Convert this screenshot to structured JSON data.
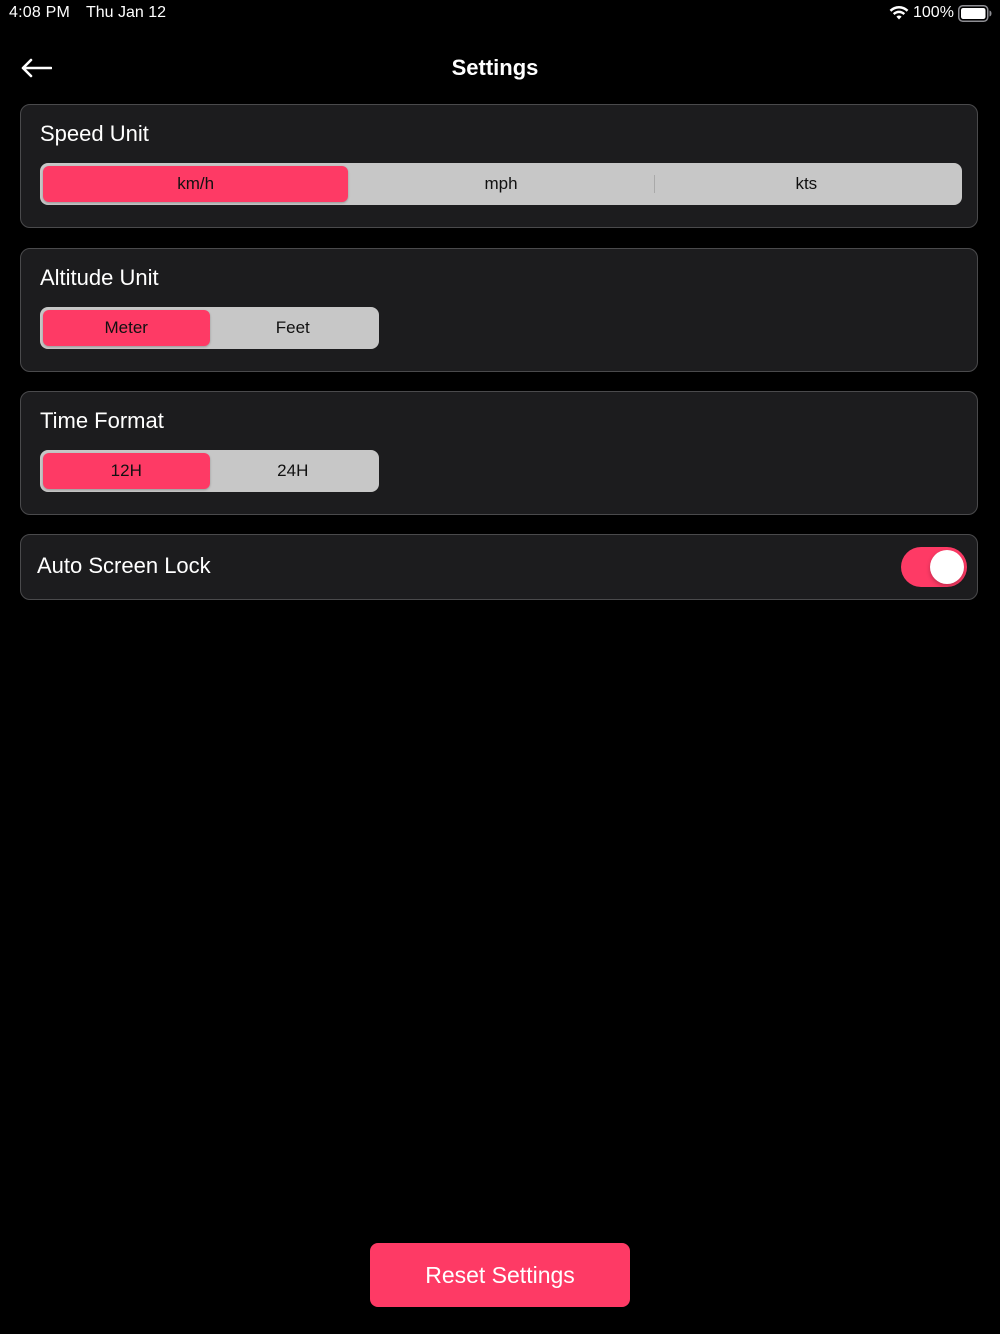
{
  "status_bar": {
    "time": "4:08 PM",
    "date": "Thu Jan 12",
    "battery_percent": "100%",
    "icons": [
      "wifi-icon",
      "battery-icon"
    ]
  },
  "nav": {
    "title": "Settings",
    "back_icon": "arrow-left-icon"
  },
  "speed_unit": {
    "title": "Speed Unit",
    "options": [
      "km/h",
      "mph",
      "kts"
    ],
    "selected": "km/h"
  },
  "altitude_unit": {
    "title": "Altitude Unit",
    "options": [
      "Meter",
      "Feet"
    ],
    "selected": "Meter"
  },
  "time_format": {
    "title": "Time Format",
    "options": [
      "12H",
      "24H"
    ],
    "selected": "12H"
  },
  "auto_screen_lock": {
    "label": "Auto Screen Lock",
    "enabled": true
  },
  "reset_button": {
    "label": "Reset Settings"
  },
  "colors": {
    "accent": "#fe3a65",
    "background": "#000000",
    "card": "#1c1c1e",
    "segment_bg": "#c7c7c7"
  }
}
